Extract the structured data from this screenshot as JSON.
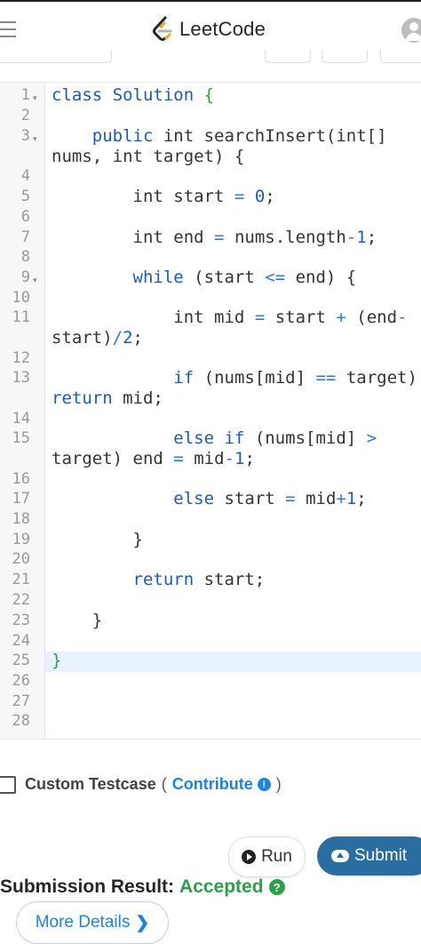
{
  "header": {
    "logo_text": "LeetCode"
  },
  "editor": {
    "line_numbers": [
      "1",
      "2",
      "3",
      "4",
      "5",
      "6",
      "7",
      "8",
      "9",
      "10",
      "11",
      "12",
      "13",
      "14",
      "15",
      "16",
      "17",
      "18",
      "19",
      "20",
      "21",
      "22",
      "23",
      "24",
      "25",
      "26",
      "27",
      "28"
    ],
    "folds": [
      "▾",
      "▾",
      "▾"
    ],
    "code": {
      "l1_kw": "class Solution",
      "l1_brace": "{",
      "l3_kw": "public",
      "l3_rest": "int searchInsert(int[]",
      "l3b": "nums, int target) {",
      "l5_a": "int start",
      "l5_op": "=",
      "l5_num": "0",
      "l5_end": ";",
      "l7_a": "int end",
      "l7_op": "=",
      "l7_b": "nums.length",
      "l7_op2": "-",
      "l7_num": "1",
      "l7_end": ";",
      "l9_kw": "while",
      "l9_a": "(start",
      "l9_op": "<=",
      "l9_b": "end) {",
      "l11_a": "int mid",
      "l11_op": "=",
      "l11_b": "start",
      "l11_op2": "+",
      "l11_c": "(end",
      "l11_op3": "-",
      "l11b_a": "start)",
      "l11b_op": "/",
      "l11b_num": "2",
      "l11b_end": ";",
      "l13_kw": "if",
      "l13_a": "(nums[mid]",
      "l13_op": "==",
      "l13_b": "target)",
      "l13b_kw": "return",
      "l13b_a": "mid;",
      "l15_kw": "else if",
      "l15_a": "(nums[mid]",
      "l15_op": ">",
      "l15b_a": "target) end",
      "l15b_op": "=",
      "l15b_b": "mid",
      "l15b_op2": "-",
      "l15b_num": "1",
      "l15b_end": ";",
      "l17_kw": "else",
      "l17_a": "start",
      "l17_op": "=",
      "l17_b": "mid",
      "l17_op2": "+",
      "l17_num": "1",
      "l17_end": ";",
      "l19": "}",
      "l21_kw": "return",
      "l21_a": "start;",
      "l23": "}",
      "l25": "}"
    }
  },
  "testcase": {
    "label": "Custom Testcase",
    "paren_open": "(",
    "contribute": "Contribute",
    "info_glyph": "!",
    "paren_close": ")"
  },
  "actions": {
    "run_label": "Run",
    "submit_label": "Submit"
  },
  "result": {
    "label": "Submission Result:",
    "status": "Accepted",
    "help_glyph": "?",
    "details_label": "More Details",
    "details_chevron": "❯"
  },
  "colors": {
    "accent_blue": "#1a85e0",
    "submit_bg": "#2a6da0",
    "accepted_green": "#2ca049",
    "keyword": "#1c5ab3"
  }
}
